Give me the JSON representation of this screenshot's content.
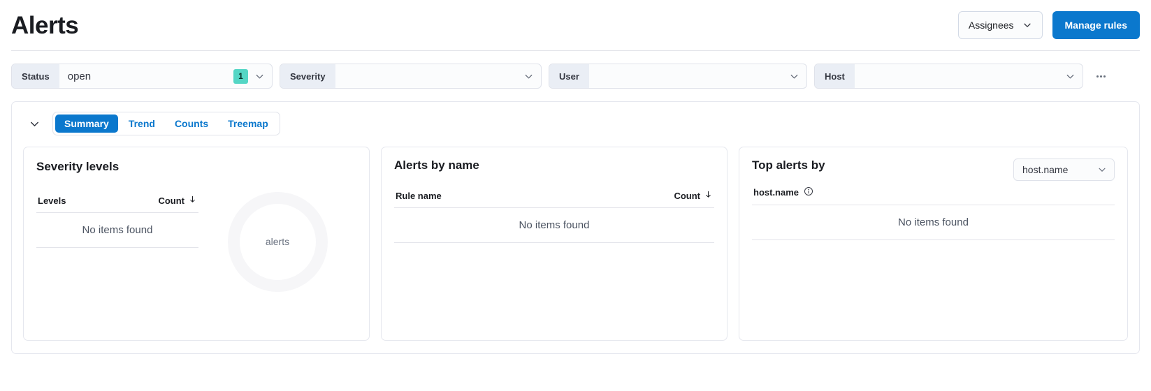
{
  "header": {
    "title": "Alerts",
    "assignees_label": "Assignees",
    "manage_rules_label": "Manage rules"
  },
  "filters": [
    {
      "label": "Status",
      "value": "open",
      "badge": "1",
      "has_badge": true,
      "icon": "chevron-down-icon"
    },
    {
      "label": "Severity",
      "value": "",
      "badge": "",
      "has_badge": false,
      "icon": "chevron-down-icon"
    },
    {
      "label": "User",
      "value": "",
      "badge": "",
      "has_badge": false,
      "icon": "chevron-down-icon"
    },
    {
      "label": "Host",
      "value": "",
      "badge": "",
      "has_badge": false,
      "icon": "chevron-down-icon"
    }
  ],
  "filter_more_icon": "more-options-icon",
  "summary": {
    "collapse_icon": "chevron-down-icon",
    "tabs": [
      {
        "label": "Summary",
        "active": true
      },
      {
        "label": "Trend",
        "active": false
      },
      {
        "label": "Counts",
        "active": false
      },
      {
        "label": "Treemap",
        "active": false
      }
    ]
  },
  "severity_card": {
    "title": "Severity levels",
    "col_levels": "Levels",
    "col_count": "Count",
    "sort_icon": "sort-down-arrow-icon",
    "empty_text": "No items found",
    "donut_label": "alerts"
  },
  "byname_card": {
    "title": "Alerts by name",
    "col_rule_name": "Rule name",
    "col_count": "Count",
    "sort_icon": "sort-down-arrow-icon",
    "empty_text": "No items found"
  },
  "topalerts_card": {
    "title": "Top alerts by",
    "select_value": "host.name",
    "select_icon": "chevron-down-icon",
    "col_field": "host.name",
    "info_icon": "info-circle-icon",
    "empty_text": "No items found"
  },
  "colors": {
    "primary": "#0b78cd",
    "badge": "#54d6c5",
    "border": "#e5e7ee",
    "text": "#343741"
  }
}
